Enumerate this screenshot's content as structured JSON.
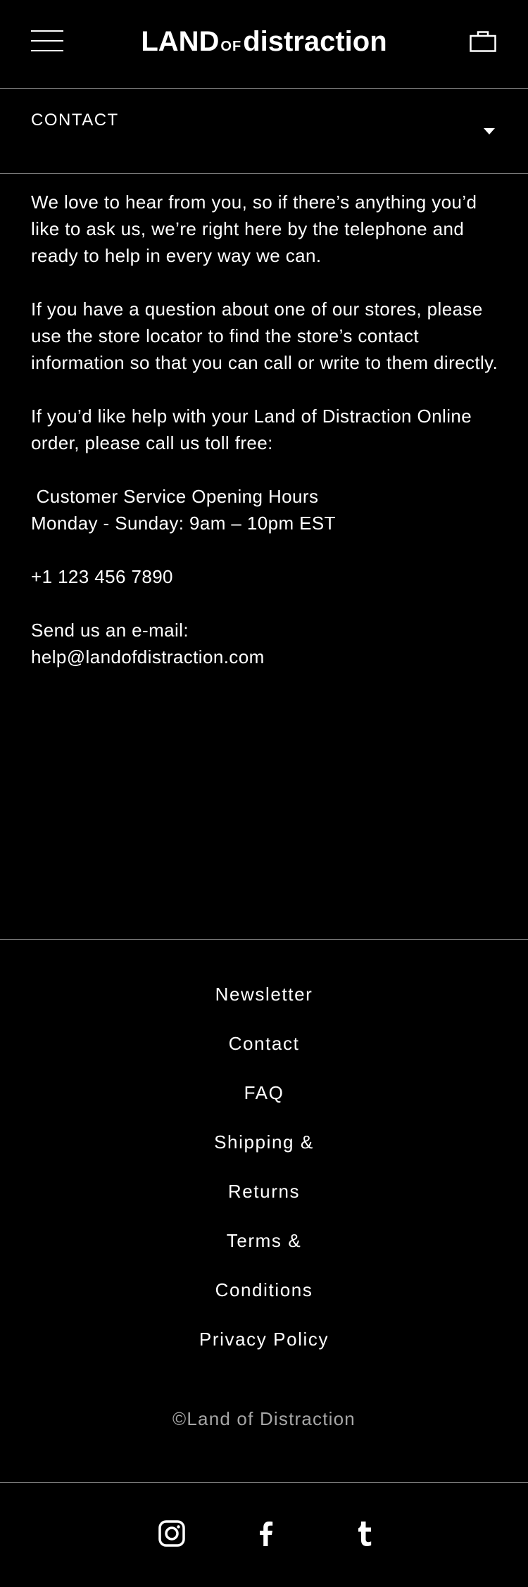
{
  "header": {
    "logo_land": "LAND",
    "logo_of": "OF",
    "logo_distraction": "distraction"
  },
  "section": {
    "title": "CONTACT"
  },
  "content": {
    "p1": "We love to hear from you, so if there’s anything you’d like to ask us, we’re right here by the telephone and ready to help in every way we can.",
    "p2": "If you have a question about one of our stores, please use the store locator to find the store’s contact information so that you can call or write to them directly.",
    "p3": "If you’d like help with your Land of Distraction Online order, please call us toll free:",
    "hours_title": " Customer Service Opening Hours",
    "hours": "Monday - Sunday: 9am – 10pm EST",
    "phone": "+1 123 456 7890",
    "email_label": "Send us an e-mail:",
    "email": "help@landofdistraction.com"
  },
  "footer": {
    "links": [
      "Newsletter",
      "Contact",
      "FAQ",
      "Shipping &",
      "Returns",
      "Terms &",
      "Conditions",
      "Privacy Policy"
    ],
    "copyright": "©Land of Distraction"
  },
  "social": [
    "instagram-icon",
    "facebook-icon",
    "tumblr-icon"
  ],
  "colors": {
    "background": "#000000",
    "text": "#ffffff",
    "divider": "#7a7a7a",
    "muted": "#a6a6a6"
  }
}
